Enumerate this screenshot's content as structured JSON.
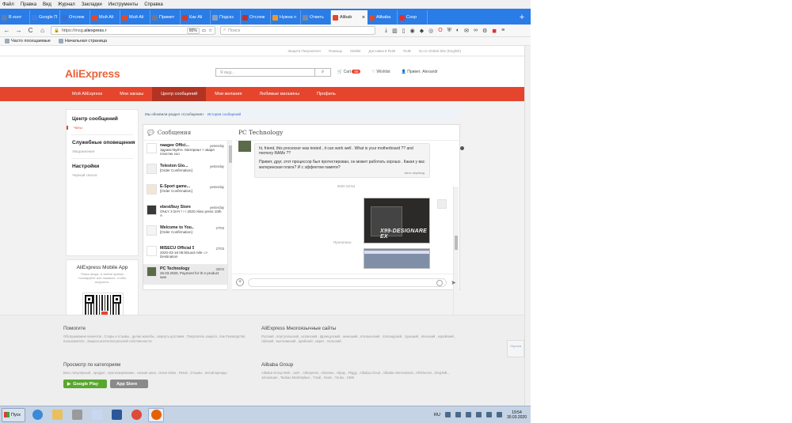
{
  "browser": {
    "menu": [
      "Файл",
      "Правка",
      "Вид",
      "Журнал",
      "Закладки",
      "Инструменты",
      "Справка"
    ],
    "tabs": [
      {
        "label": "В конт",
        "color": "#5b7fb8"
      },
      {
        "label": "Google П",
        "color": "#3d7ee6"
      },
      {
        "label": "Отслеж",
        "color": "#3b6fd0"
      },
      {
        "label": "Мой Ali",
        "color": "#e04a2a"
      },
      {
        "label": "Мой Ali",
        "color": "#e04a2a"
      },
      {
        "label": "Примет",
        "color": "#6a7a90"
      },
      {
        "label": "Как Ali",
        "color": "#d23b2b"
      },
      {
        "label": "Подскз",
        "color": "#8aa0c0"
      },
      {
        "label": "Отслеж",
        "color": "#c0302a"
      },
      {
        "label": "Нужна п",
        "color": "#f09a20"
      },
      {
        "label": "Ответь",
        "color": "#7a8aa0"
      },
      {
        "label": "Alibab",
        "color": "#e04a2a",
        "active": true
      },
      {
        "label": "Alibaba",
        "color": "#e04a2a"
      },
      {
        "label": "Соор",
        "color": "#e03030"
      }
    ],
    "nav_back": "←",
    "nav_forward": "→",
    "nav_reload": "C",
    "nav_home": "⌂",
    "url_prefix": "https://msg.",
    "url_domain": "aliexpress.r",
    "zoom": "80%",
    "search_placeholder": "Поиск",
    "bookmarks": [
      "Часто посещаемые",
      "Начальная страница"
    ]
  },
  "site": {
    "topline": [
      "Защита Покупателя",
      "Помощь",
      "Mobile",
      "Доставка в RUB",
      "RUB",
      "Go to Global Site (English)"
    ],
    "logo": "AliExpress",
    "search_placeholder": "Я ищу...",
    "search_icon": "⌕",
    "cart_label": "Cart",
    "cart_count": "56",
    "wishlist_label": "Wishlist",
    "user_greeting": "Привет, Alexandr",
    "nav": [
      {
        "label": "Мой AliExpress"
      },
      {
        "label": "Мои заказы"
      },
      {
        "label": "Центр сообщений",
        "active": true
      },
      {
        "label": "Мои желания"
      },
      {
        "label": "Любимые магазины"
      },
      {
        "label": "Профиль"
      }
    ]
  },
  "sidebar": {
    "sections": [
      {
        "title": "Центр сообщений",
        "items": [
          "Чаты"
        ]
      },
      {
        "title": "Служебные оповещения",
        "items": [
          "Уведомления"
        ]
      },
      {
        "title": "Настройки",
        "items": [
          "Черный список"
        ]
      }
    ],
    "app": {
      "title": "AliExpress Mobile App",
      "desc": "Поиск везде, в любое время! Сканируйте или нажмите, чтобы загрузить."
    }
  },
  "breadcrumb": {
    "text": "Мы обновили раздел «Сообщения»",
    "link": "История сообщений"
  },
  "chat": {
    "list_title": "Сообщения",
    "conversations": [
      {
        "name": "naagee Offici...",
        "time": "yesterday",
        "preview": "Здравствуйте. Материал т оваря пластик хоо",
        "avatar": "#ffffff"
      },
      {
        "name": "Teleston Glo...",
        "time": "yesterday",
        "preview": "[Order Confirmation]",
        "avatar": "#f0f0f0"
      },
      {
        "name": "E-Sport game...",
        "time": "yesterday",
        "preview": "[Order Confirmation]",
        "avatar": "#f3e6d8"
      },
      {
        "name": "ebest/buy Store",
        "time": "yesterday",
        "preview": "ONLY 3 DAY ! ! ! 2020 Aliex press 10th A",
        "avatar": "#3a3a3a"
      },
      {
        "name": "Welcome to You...",
        "time": "27/03",
        "preview": "[Order Confirmation]",
        "avatar": "#f5f5f5"
      },
      {
        "name": "MISECU Official S...",
        "time": "27/03",
        "preview": "2020-03-18 06:50Last mile => Destination",
        "avatar": "#ffffff"
      },
      {
        "name": "PC Technology",
        "time": "26/03",
        "preview": "26.03.2020, Payment for th e product was",
        "avatar": "#5a6a4a",
        "selected": true
      }
    ],
    "conversation_title": "PC Technology",
    "message_original": "hi, friend, this processor was tested , it can work well . What is your motherboard ?? and memory RAMs ??",
    "message_translated": "Привет, друг, этот процессор был протестирован, он может работать хорошо . Какая у вас материнская плата? И с эффектом памяти?",
    "translation_source": "Авто-перевод",
    "timestamp": "2020 20:54",
    "read_label": "Прочитано",
    "image_brand": "X99-DESIGNARE EX"
  },
  "footer": {
    "help_title": "Помогите",
    "help_text": "Обслуживание клиентов , Споры и отзывы , делая жалобы , вернуть доставки , Покупатель защита , Как Руководство пользователя , Защита интеллектуальной собственности",
    "browse_title": "Просмотр по категориям",
    "browse_text": "Весь популярный , продукт , прогнозирование , низкая цена , Great Value , Retail , Отзывы , Китай Бренды",
    "lang_title": "AliExpress Многоязычные сайты",
    "lang_text": "Русский , португальский , испанский , французский , немецкий , итальянский , голландский , турецкий , японский , корейский , тайский , вьетнамский , арабский , иврит , польский",
    "group_title": "Alibaba Group",
    "group_text": "Alibaba Group Web , сайт , AliExpress , Alimama , Alipay , Fliggy , Alibaba Cloud , Alibaba International , AliTelecom , DingTalk , Juhuasuan , Taobao Marketplace , Tmall , Xiami , Youku , 1688",
    "google_play": "Google Play",
    "app_store": "App Store",
    "feedback": "Оценка"
  },
  "taskbar": {
    "start": "Пуск",
    "apps": [
      {
        "name": "ie",
        "color": "#3a8ad6"
      },
      {
        "name": "folder",
        "color": "#e8c060"
      },
      {
        "name": "media",
        "color": "#9a9a9a"
      },
      {
        "name": "notepad",
        "color": "#c8d8f0"
      },
      {
        "name": "word",
        "color": "#2b579a"
      },
      {
        "name": "chrome",
        "color": "#dd4b39"
      },
      {
        "name": "firefox",
        "color": "#e66000",
        "active": true
      }
    ],
    "lang": "RU",
    "time": "19:54",
    "date": "30.03.2020"
  }
}
